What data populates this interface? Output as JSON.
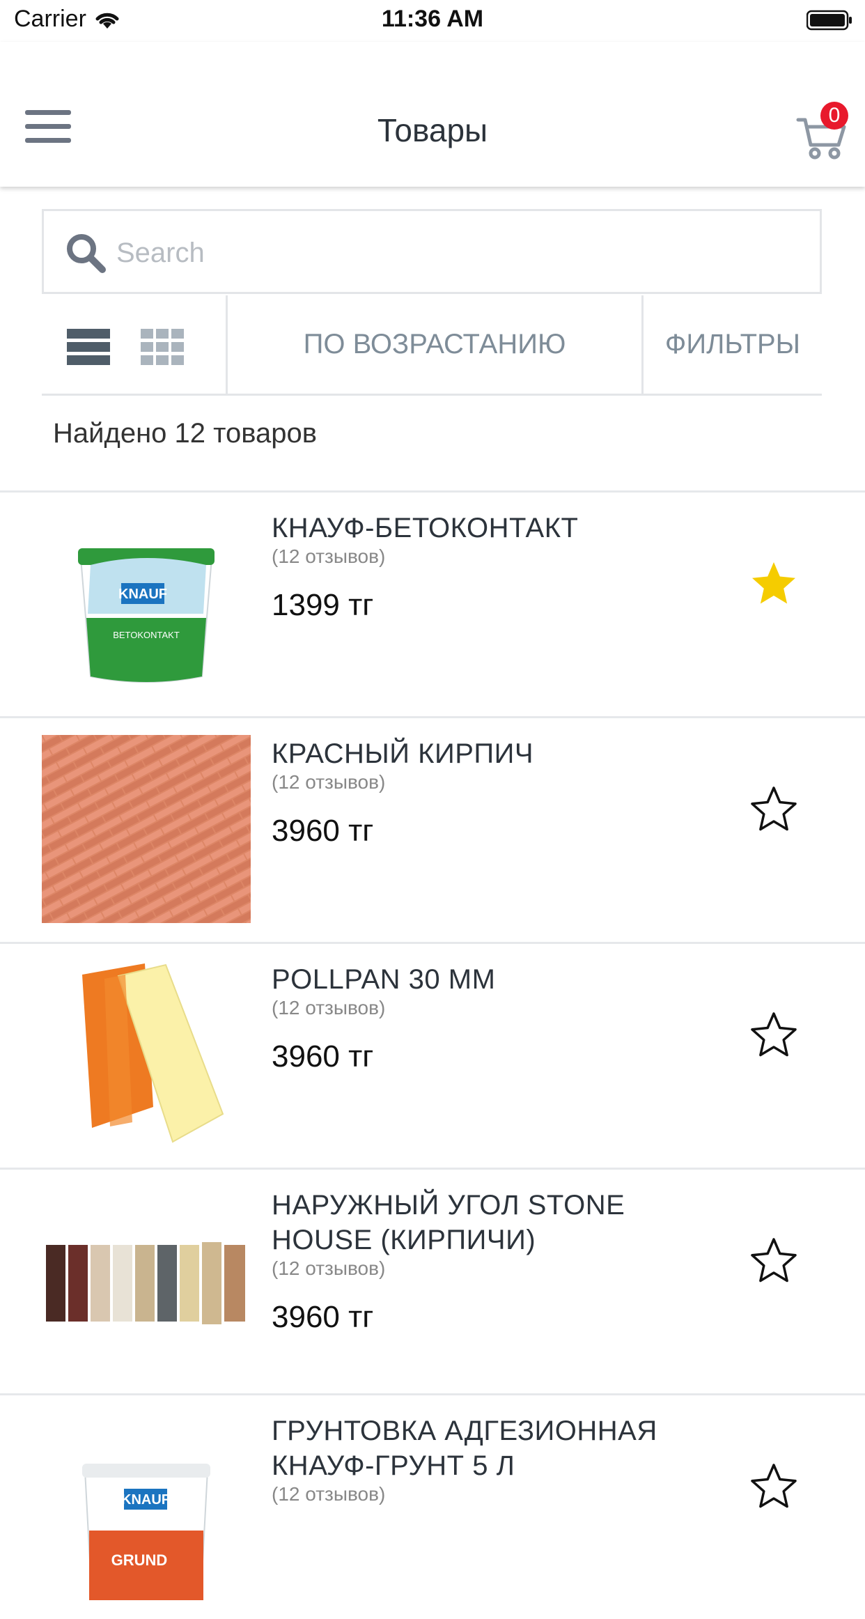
{
  "status": {
    "carrier": "Carrier",
    "time": "11:36 AM"
  },
  "header": {
    "title": "Товары",
    "cart_count": "0"
  },
  "search": {
    "placeholder": "Search",
    "value": ""
  },
  "toolbar": {
    "sort_label": "ПО ВОЗРАСТАНИЮ",
    "filter_label": "ФИЛЬТРЫ"
  },
  "results": {
    "found_text": "Найдено 12 товаров"
  },
  "products": [
    {
      "name": "КНАУФ-БЕТОКОНТАКТ",
      "reviews": "(12 отзывов)",
      "price": "1399 тг",
      "favorite": true
    },
    {
      "name": "КРАСНЫЙ КИРПИЧ",
      "reviews": "(12 отзывов)",
      "price": "3960 тг",
      "favorite": false
    },
    {
      "name": "POLLPAN 30 ММ",
      "reviews": "(12 отзывов)",
      "price": "3960 тг",
      "favorite": false
    },
    {
      "name": "НАРУЖНЫЙ УГОЛ STONE HOUSE (КИРПИЧИ)",
      "reviews": "(12 отзывов)",
      "price": "3960 тг",
      "favorite": false
    },
    {
      "name": "ГРУНТОВКА АДГЕЗИОННАЯ КНАУФ-ГРУНТ 5 Л",
      "reviews": "(12 отзывов)",
      "price": "",
      "favorite": false
    }
  ],
  "colors": {
    "accent_badge": "#e8192c",
    "star_filled": "#f5cc00",
    "toolbar_text": "#7e8c98"
  },
  "icons": [
    "wifi-icon",
    "battery-icon",
    "menu-icon",
    "cart-icon",
    "search-icon",
    "list-view-icon",
    "grid-view-icon",
    "star-icon"
  ]
}
